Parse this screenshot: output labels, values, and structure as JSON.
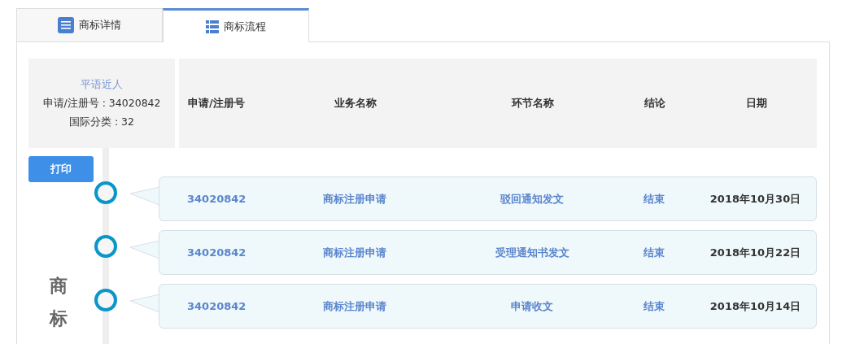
{
  "tabs": [
    {
      "label": "商标详情",
      "kind": "document",
      "selected": false
    },
    {
      "label": "商标流程",
      "kind": "list",
      "selected": true
    }
  ],
  "trademark": {
    "name": "平语近人",
    "registration": "申请/注册号 : 34020842",
    "class": "国际分类 : 32"
  },
  "columns": [
    "申请/注册号",
    "业务名称",
    "环节名称",
    "结论",
    "日期"
  ],
  "print_button": "打印",
  "side_title": "商标",
  "rows": [
    {
      "number": "34020842",
      "business": "商标注册申请",
      "step": "驳回通知发文",
      "result": "结束",
      "date": "2018年10月30日"
    },
    {
      "number": "34020842",
      "business": "商标注册申请",
      "step": "受理通知书发文",
      "result": "结束",
      "date": "2018年10月22日"
    },
    {
      "number": "34020842",
      "business": "商标注册申请",
      "step": "申请收文",
      "result": "结束",
      "date": "2018年10月14日"
    }
  ]
}
